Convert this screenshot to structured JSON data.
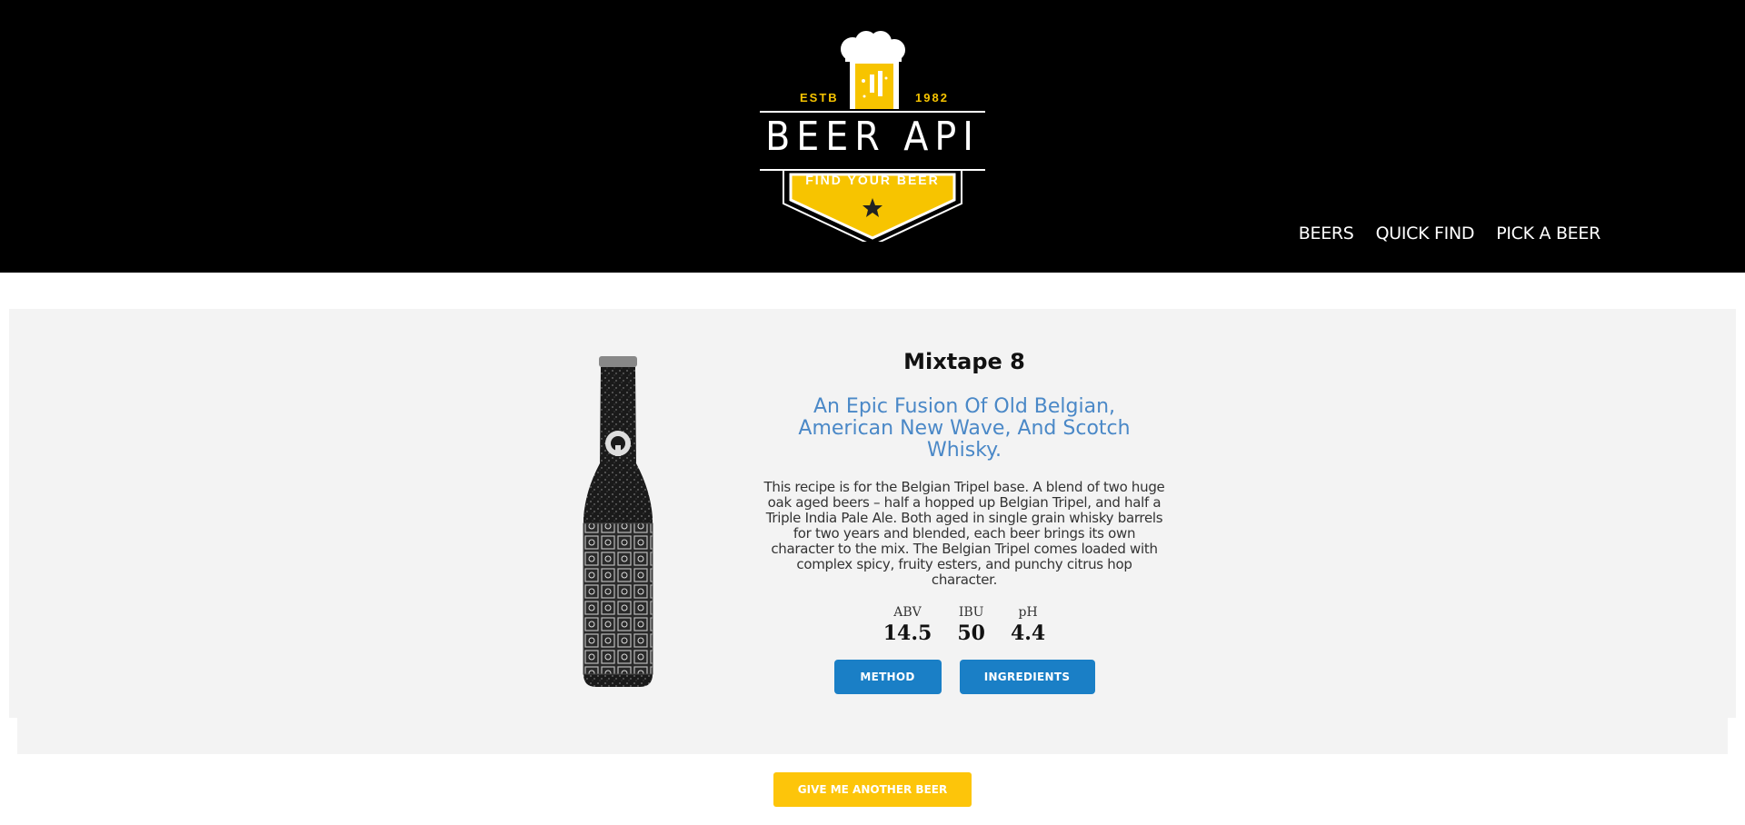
{
  "header": {
    "logo": {
      "estb": "ESTB",
      "year": "1982",
      "title": "BEER API",
      "tagline": "FIND YOUR BEER"
    },
    "nav": [
      {
        "label": "BEERS"
      },
      {
        "label": "QUICK FIND"
      },
      {
        "label": "PICK A BEER"
      }
    ]
  },
  "beer": {
    "name": "Mixtape 8",
    "tagline": "An Epic Fusion Of Old Belgian, American New Wave, And Scotch Whisky.",
    "description": "This recipe is for the Belgian Tripel base. A blend of two huge oak aged beers – half a hopped up Belgian Tripel, and half a Triple India Pale Ale. Both aged in single grain whisky barrels for two years and blended, each beer brings its own character to the mix. The Belgian Tripel comes loaded with complex spicy, fruity esters, and punchy citrus hop character.",
    "stats": {
      "abv_label": "ABV",
      "abv": "14.5",
      "ibu_label": "IBU",
      "ibu": "50",
      "ph_label": "pH",
      "ph": "4.4"
    }
  },
  "buttons": {
    "method": "METHOD",
    "ingredients": "INGREDIENTS",
    "another": "GIVE ME ANOTHER BEER"
  },
  "colors": {
    "header_bg": "#000000",
    "accent_yellow": "#fdc50a",
    "button_blue": "#1a7fc6",
    "tagline_blue": "#4a88c7",
    "card_bg": "#f3f3f3"
  }
}
